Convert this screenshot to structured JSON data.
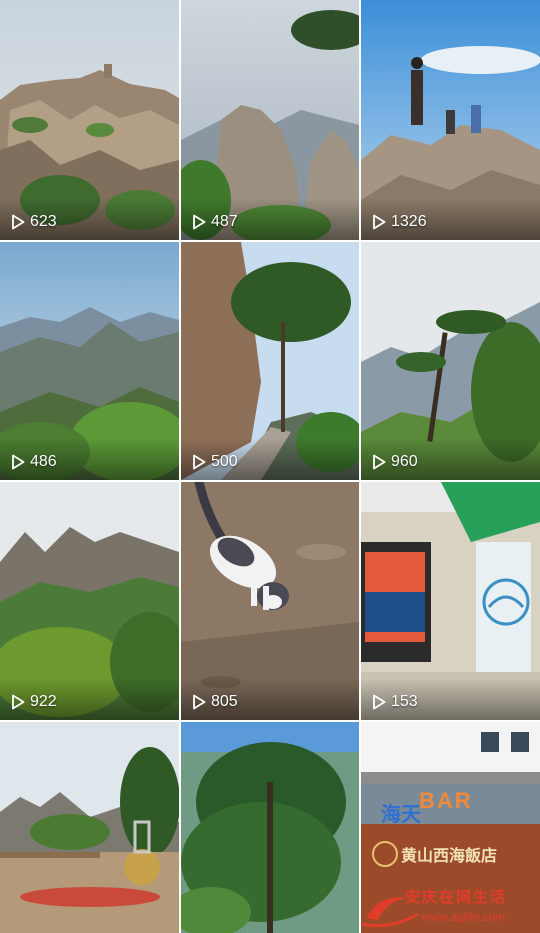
{
  "tiles": [
    {
      "views": "623"
    },
    {
      "views": "487"
    },
    {
      "views": "1326"
    },
    {
      "views": "486"
    },
    {
      "views": "500"
    },
    {
      "views": "960"
    },
    {
      "views": "922"
    },
    {
      "views": "805"
    },
    {
      "views": "153"
    },
    {
      "views": ""
    },
    {
      "views": ""
    },
    {
      "views": ""
    }
  ],
  "signage": {
    "bar_text": "BAR",
    "sign_left": "海天",
    "hotel_name": "黄山西海飯店"
  },
  "watermark": {
    "text": "安庆在网生活",
    "url": "www.aqlife.com"
  },
  "icons": {
    "play": "play-icon"
  }
}
